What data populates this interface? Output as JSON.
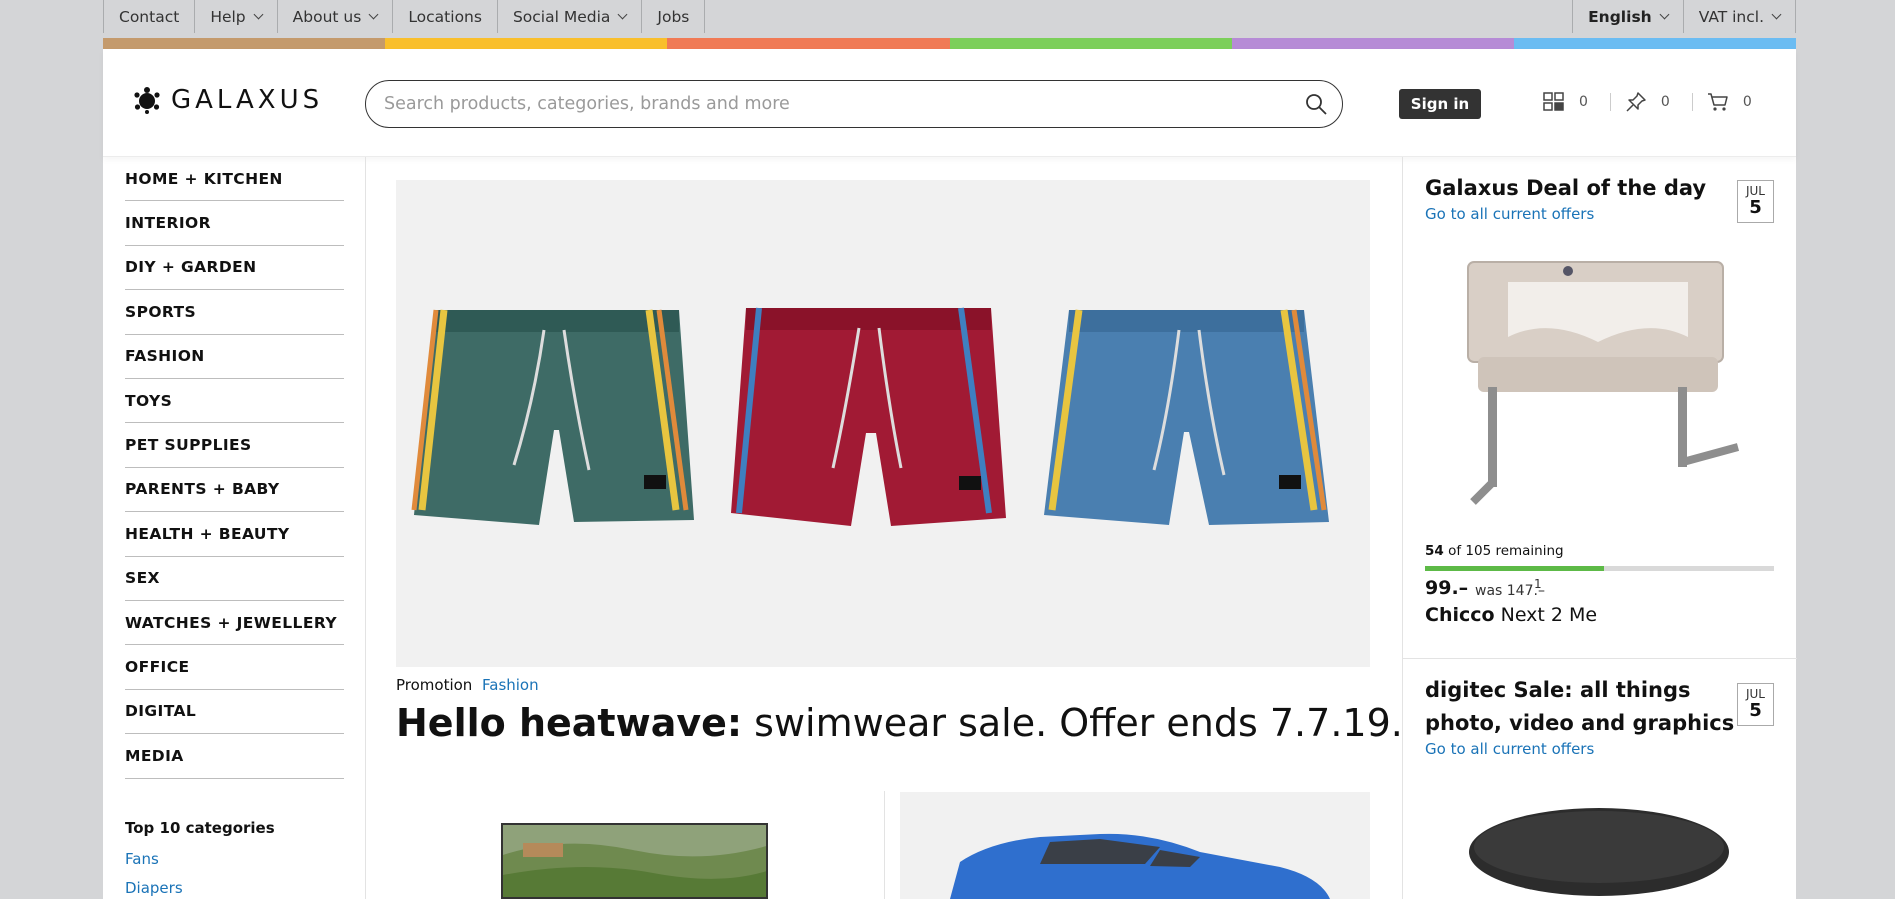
{
  "topnav": {
    "items": [
      {
        "label": "Contact",
        "dropdown": false
      },
      {
        "label": "Help",
        "dropdown": true
      },
      {
        "label": "About us",
        "dropdown": true
      },
      {
        "label": "Locations",
        "dropdown": false
      },
      {
        "label": "Social Media",
        "dropdown": true
      },
      {
        "label": "Jobs",
        "dropdown": false
      }
    ],
    "language": "English",
    "vat": "VAT incl."
  },
  "colors": {
    "brand_stripes": [
      "#c49a6c",
      "#f9bf2c",
      "#f07a55",
      "#7ccf5a",
      "#b68bd6",
      "#6bbcf2"
    ],
    "link": "#1a73b7",
    "progress": "#5dba47"
  },
  "header": {
    "logo_text": "GALAXUS",
    "search_placeholder": "Search products, categories, brands and more",
    "signin_label": "Sign in",
    "compare_count": "0",
    "wishlist_count": "0",
    "cart_count": "0"
  },
  "sidebar": {
    "categories": [
      "HOME + KITCHEN",
      "INTERIOR",
      "DIY + GARDEN",
      "SPORTS",
      "FASHION",
      "TOYS",
      "PET SUPPLIES",
      "PARENTS + BABY",
      "HEALTH + BEAUTY",
      "SEX",
      "WATCHES + JEWELLERY",
      "OFFICE",
      "DIGITAL",
      "MEDIA"
    ],
    "top10_title": "Top 10 categories",
    "top10_links": [
      "Fans",
      "Diapers"
    ]
  },
  "main": {
    "promo_label": "Promotion",
    "promo_category": "Fashion",
    "headline_bold": "Hello heatwave:",
    "headline_rest": " swimwear sale. Offer ends 7.7.19."
  },
  "deals": [
    {
      "title": "Galaxus Deal of the day",
      "link": "Go to all current offers",
      "month": "JUL",
      "day": "5",
      "remaining_count": "54",
      "remaining_text": " of 105 remaining",
      "remaining_fraction": 0.514,
      "price": "99.–",
      "was": "was 147.–",
      "footnote": "1",
      "brand": "Chicco",
      "product": "Next 2 Me"
    },
    {
      "title_line1": "digitec Sale: all things",
      "title_line2": "photo, video and graphics",
      "link": "Go to all current offers",
      "month": "JUL",
      "day": "5"
    }
  ]
}
